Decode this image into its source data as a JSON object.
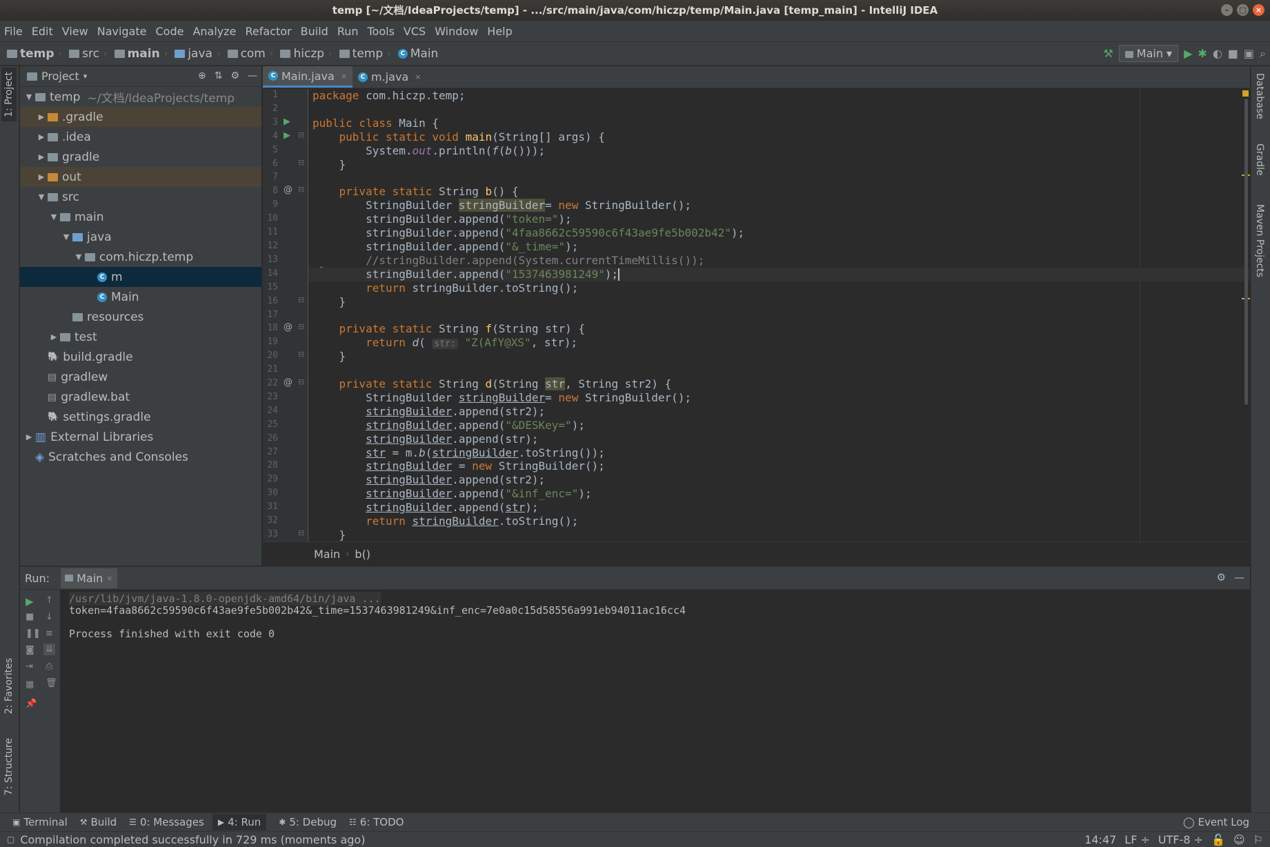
{
  "window": {
    "title": "temp [~/文档/IdeaProjects/temp] - .../src/main/java/com/hiczp/temp/Main.java [temp_main] - IntelliJ IDEA"
  },
  "menu": [
    "File",
    "Edit",
    "View",
    "Navigate",
    "Code",
    "Analyze",
    "Refactor",
    "Build",
    "Run",
    "Tools",
    "VCS",
    "Window",
    "Help"
  ],
  "breadcrumbs": [
    "temp",
    "src",
    "main",
    "java",
    "com",
    "hiczp",
    "temp",
    "Main"
  ],
  "run_config": {
    "label": "Main"
  },
  "project_panel": {
    "title": "Project",
    "tree": [
      {
        "label": "temp",
        "hint": "~/文档/IdeaProjects/temp",
        "indent": 0,
        "arrow": "down",
        "icon": "folder"
      },
      {
        "label": ".gradle",
        "indent": 1,
        "arrow": "right",
        "icon": "folder-orange",
        "highlight": true
      },
      {
        "label": ".idea",
        "indent": 1,
        "arrow": "right",
        "icon": "folder"
      },
      {
        "label": "gradle",
        "indent": 1,
        "arrow": "right",
        "icon": "folder"
      },
      {
        "label": "out",
        "indent": 1,
        "arrow": "right",
        "icon": "folder-orange",
        "highlight": true
      },
      {
        "label": "src",
        "indent": 1,
        "arrow": "down",
        "icon": "folder"
      },
      {
        "label": "main",
        "indent": 2,
        "arrow": "down",
        "icon": "folder"
      },
      {
        "label": "java",
        "indent": 3,
        "arrow": "down",
        "icon": "folder-blue"
      },
      {
        "label": "com.hiczp.temp",
        "indent": 4,
        "arrow": "down",
        "icon": "package"
      },
      {
        "label": "m",
        "indent": 5,
        "arrow": "",
        "icon": "class",
        "selected": true
      },
      {
        "label": "Main",
        "indent": 5,
        "arrow": "",
        "icon": "class-run"
      },
      {
        "label": "resources",
        "indent": 3,
        "arrow": "",
        "icon": "folder"
      },
      {
        "label": "test",
        "indent": 2,
        "arrow": "right",
        "icon": "folder"
      },
      {
        "label": "build.gradle",
        "indent": 1,
        "arrow": "",
        "icon": "gradle"
      },
      {
        "label": "gradlew",
        "indent": 1,
        "arrow": "",
        "icon": "file"
      },
      {
        "label": "gradlew.bat",
        "indent": 1,
        "arrow": "",
        "icon": "file"
      },
      {
        "label": "settings.gradle",
        "indent": 1,
        "arrow": "",
        "icon": "gradle"
      },
      {
        "label": "External Libraries",
        "indent": 0,
        "arrow": "right",
        "icon": "libs"
      },
      {
        "label": "Scratches and Consoles",
        "indent": 0,
        "arrow": "",
        "icon": "scratch"
      }
    ]
  },
  "editor": {
    "tabs": [
      {
        "label": "Main.java",
        "active": true
      },
      {
        "label": "m.java",
        "active": false
      }
    ],
    "current_line": 14,
    "lines": [
      [
        [
          "kw",
          "package "
        ],
        [
          "",
          "com.hiczp.temp;"
        ]
      ],
      [],
      [
        [
          "kw",
          "public class "
        ],
        [
          "",
          "Main {"
        ]
      ],
      [
        [
          "",
          "    "
        ],
        [
          "kw",
          "public static void "
        ],
        [
          "fn",
          "main"
        ],
        [
          "",
          "(String[] args) {"
        ]
      ],
      [
        [
          "",
          "        System."
        ],
        [
          "fld",
          "out"
        ],
        [
          "",
          ".println("
        ],
        [
          "it",
          "f"
        ],
        [
          "",
          "("
        ],
        [
          "it",
          "b"
        ],
        [
          "",
          "()));"
        ]
      ],
      [
        [
          "",
          "    }"
        ]
      ],
      [],
      [
        [
          "",
          "    "
        ],
        [
          "kw",
          "private static "
        ],
        [
          "",
          "String "
        ],
        [
          "fn",
          "b"
        ],
        [
          "",
          "() {"
        ]
      ],
      [
        [
          "",
          "        StringBuilder "
        ],
        [
          "hlw",
          "stringBuilder"
        ],
        [
          "",
          ""
        ],
        [
          "",
          "",
          " "
        ],
        [
          "",
          ""
        ],
        [
          "",
          "= "
        ],
        [
          "kw",
          "new "
        ],
        [
          "",
          "StringBuilder();"
        ]
      ],
      [
        [
          "",
          "        stringBuilder.append("
        ],
        [
          "str",
          "\"token=\""
        ],
        [
          "",
          ");"
        ]
      ],
      [
        [
          "",
          "        stringBuilder.append("
        ],
        [
          "str",
          "\"4faa8662c59590c6f43ae9fe5b002b42\""
        ],
        [
          "",
          ");"
        ]
      ],
      [
        [
          "",
          "        stringBuilder.append("
        ],
        [
          "str",
          "\"&_time=\""
        ],
        [
          "",
          ");"
        ]
      ],
      [
        [
          "cmt",
          "        //stringBuilder.append(System.currentTimeMillis());"
        ]
      ],
      [
        [
          "",
          "        stringBuilder.append("
        ],
        [
          "str",
          "\"1537463981249\""
        ],
        [
          "",
          ");"
        ],
        [
          "caret",
          ""
        ]
      ],
      [
        [
          "",
          "        "
        ],
        [
          "kw",
          "return "
        ],
        [
          "",
          "stringBuilder.toString();"
        ]
      ],
      [
        [
          "",
          "    }"
        ]
      ],
      [],
      [
        [
          "",
          "    "
        ],
        [
          "kw",
          "private static "
        ],
        [
          "",
          "String "
        ],
        [
          "fn",
          "f"
        ],
        [
          "",
          "(String str) {"
        ]
      ],
      [
        [
          "",
          "        "
        ],
        [
          "kw",
          "return "
        ],
        [
          "it",
          "d"
        ],
        [
          "",
          "( "
        ],
        [
          "hint",
          "str:"
        ],
        [
          "str",
          " \"Z(AfY@XS\""
        ],
        [
          "",
          ", str);"
        ]
      ],
      [
        [
          "",
          "    }"
        ]
      ],
      [],
      [
        [
          "",
          "    "
        ],
        [
          "kw",
          "private static "
        ],
        [
          "",
          "String "
        ],
        [
          "fn",
          "d"
        ],
        [
          "",
          "(String "
        ],
        [
          "hlw",
          "str"
        ],
        [
          "",
          ", String str2) {"
        ]
      ],
      [
        [
          "",
          "        StringBuilder "
        ],
        [
          "ul",
          "stringBuilder"
        ],
        [
          "",
          "",
          " "
        ],
        [
          "",
          ""
        ],
        [
          "",
          "= "
        ],
        [
          "kw",
          "new "
        ],
        [
          "",
          "StringBuilder();"
        ]
      ],
      [
        [
          "",
          "        "
        ],
        [
          "ul",
          "stringBuilder"
        ],
        [
          "",
          ".append(str2);"
        ]
      ],
      [
        [
          "",
          "        "
        ],
        [
          "ul",
          "stringBuilder"
        ],
        [
          "",
          ".append("
        ],
        [
          "str",
          "\"&DESKey=\""
        ],
        [
          "",
          ");"
        ]
      ],
      [
        [
          "",
          "        "
        ],
        [
          "ul",
          "stringBuilder"
        ],
        [
          "",
          ".append(str);"
        ]
      ],
      [
        [
          "",
          "        "
        ],
        [
          "ul",
          "str"
        ],
        [
          "",
          " = m."
        ],
        [
          "it",
          "b"
        ],
        [
          "",
          "("
        ],
        [
          "ul",
          "stringBuilder"
        ],
        [
          "",
          ".toString());"
        ]
      ],
      [
        [
          "",
          "        "
        ],
        [
          "ul",
          "stringBuilder"
        ],
        [
          "",
          " = "
        ],
        [
          "kw",
          "new "
        ],
        [
          "",
          "StringBuilder();"
        ]
      ],
      [
        [
          "",
          "        "
        ],
        [
          "ul",
          "stringBuilder"
        ],
        [
          "",
          ".append(str2);"
        ]
      ],
      [
        [
          "",
          "        "
        ],
        [
          "ul",
          "stringBuilder"
        ],
        [
          "",
          ".append("
        ],
        [
          "str",
          "\"&inf_enc=\""
        ],
        [
          "",
          ");"
        ]
      ],
      [
        [
          "",
          "        "
        ],
        [
          "ul",
          "stringBuilder"
        ],
        [
          "",
          ".append("
        ],
        [
          "ul",
          "str"
        ],
        [
          "",
          ");"
        ]
      ],
      [
        [
          "",
          "        "
        ],
        [
          "kw",
          "return "
        ],
        [
          "ul",
          "stringBuilder"
        ],
        [
          "",
          ".toString();"
        ]
      ],
      [
        [
          "",
          "    }"
        ]
      ]
    ],
    "breadcrumb": [
      "Main",
      "b()"
    ]
  },
  "run_panel": {
    "label": "Run:",
    "tab": "Main",
    "console": [
      {
        "text": "/usr/lib/jvm/java-1.8.0-openjdk-amd64/bin/java ...",
        "type": "cmd"
      },
      {
        "text": "token=4faa8662c59590c6f43ae9fe5b002b42&_time=1537463981249&inf_enc=7e0a0c15d58556a991eb94011ac16cc4",
        "type": "out"
      },
      {
        "text": "",
        "type": "out"
      },
      {
        "text": "Process finished with exit code 0",
        "type": "out"
      }
    ]
  },
  "side_tabs": {
    "left": [
      "1: Project",
      "2: Favorites",
      "7: Structure"
    ],
    "right": [
      "Database",
      "Gradle",
      "Maven Projects"
    ]
  },
  "bottom_tabs": [
    {
      "label": "Terminal",
      "icon": "terminal-icon"
    },
    {
      "label": "Build",
      "icon": "hammer-icon"
    },
    {
      "label": "0: Messages",
      "icon": "messages-icon"
    },
    {
      "label": "4: Run",
      "icon": "run-icon",
      "active": true
    },
    {
      "label": "5: Debug",
      "icon": "bug-icon"
    },
    {
      "label": "6: TODO",
      "icon": "todo-icon"
    }
  ],
  "event_log": "Event Log",
  "status": {
    "message": "Compilation completed successfully in 729 ms (moments ago)",
    "position": "14:47",
    "line_sep": "LF ÷",
    "encoding": "UTF-8 ÷"
  },
  "colors": {
    "keyword": "#cc7832",
    "string": "#6a8759",
    "comment": "#808080",
    "function": "#ffc66d",
    "field": "#9876aa",
    "selection": "#0d293e"
  }
}
